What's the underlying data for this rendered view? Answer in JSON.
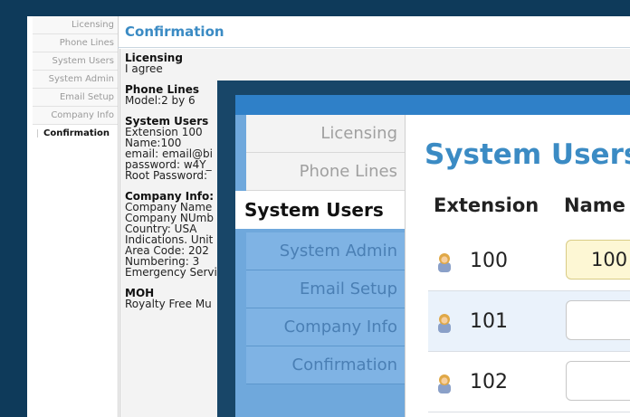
{
  "back_window": {
    "nav_items": [
      {
        "label": "Licensing"
      },
      {
        "label": "Phone Lines"
      },
      {
        "label": "System Users"
      },
      {
        "label": "System Admin"
      },
      {
        "label": "Email Setup"
      },
      {
        "label": "Company Info"
      },
      {
        "label": "Confirmation"
      }
    ],
    "title": "Confirmation",
    "sections": [
      {
        "heading": "Licensing",
        "lines": [
          "I agree"
        ]
      },
      {
        "heading": "Phone Lines",
        "lines": [
          "Model:2 by 6"
        ]
      },
      {
        "heading": "System Users",
        "lines": [
          "Extension 100",
          "Name:100",
          "email: email@bi",
          "password: w4Y_",
          "Root Password:"
        ]
      },
      {
        "heading": "Company Info:",
        "lines": [
          "Company Name",
          "Company NUmb",
          "Country: USA",
          "Indications. Unit",
          "Area Code: 202",
          "Numbering: 3",
          "Emergency Servi"
        ]
      },
      {
        "heading": "MOH",
        "lines": [
          "Royalty Free Mu"
        ]
      }
    ]
  },
  "front_window": {
    "nav_items": [
      {
        "label": "Licensing"
      },
      {
        "label": "Phone Lines"
      },
      {
        "label": "System Users"
      },
      {
        "label": "System Admin"
      },
      {
        "label": "Email Setup"
      },
      {
        "label": "Company Info"
      },
      {
        "label": "Confirmation"
      }
    ],
    "title": "System Users",
    "columns": {
      "extension": "Extension",
      "name": "Name"
    },
    "rows": [
      {
        "extension": "100",
        "name": "100"
      },
      {
        "extension": "101",
        "name": ""
      },
      {
        "extension": "102",
        "name": ""
      }
    ],
    "user_icon": "user-icon"
  }
}
